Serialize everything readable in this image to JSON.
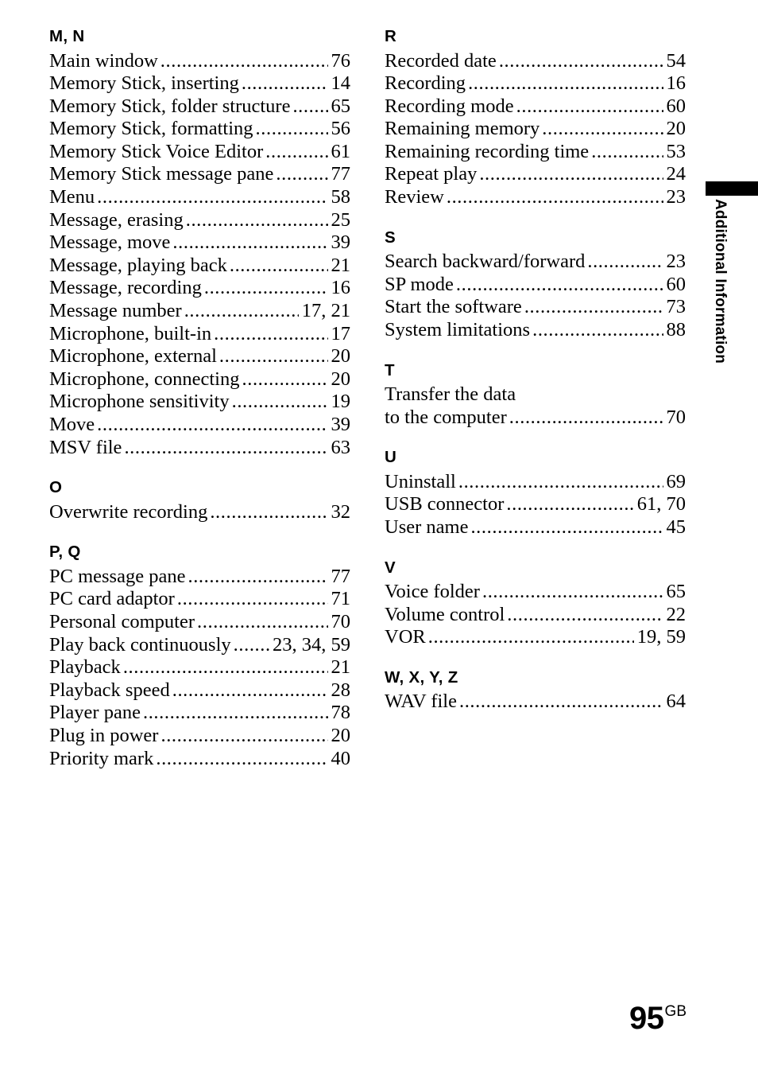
{
  "page": {
    "number": "95",
    "suffix": "GB"
  },
  "margin_tab": {
    "label": "Additional Information"
  },
  "columns": {
    "left": [
      {
        "heading": "M, N",
        "entries": [
          {
            "label": "Main window",
            "page": "76"
          },
          {
            "label": "Memory Stick, inserting",
            "page": "14"
          },
          {
            "label": "Memory Stick, folder structure",
            "page": "65"
          },
          {
            "label": "Memory Stick, formatting",
            "page": "56"
          },
          {
            "label": "Memory Stick Voice Editor",
            "page": "61"
          },
          {
            "label": "Memory Stick message pane",
            "page": "77"
          },
          {
            "label": "Menu",
            "page": "58"
          },
          {
            "label": "Message, erasing",
            "page": "25"
          },
          {
            "label": "Message, move",
            "page": "39"
          },
          {
            "label": "Message, playing back",
            "page": "21"
          },
          {
            "label": "Message, recording",
            "page": "16"
          },
          {
            "label": "Message number",
            "page": "17, 21"
          },
          {
            "label": "Microphone, built-in",
            "page": "17"
          },
          {
            "label": "Microphone, external",
            "page": "20"
          },
          {
            "label": "Microphone, connecting",
            "page": "20"
          },
          {
            "label": "Microphone sensitivity",
            "page": "19"
          },
          {
            "label": "Move",
            "page": "39"
          },
          {
            "label": "MSV file",
            "page": "63"
          }
        ]
      },
      {
        "heading": "O",
        "entries": [
          {
            "label": "Overwrite recording",
            "page": "32"
          }
        ]
      },
      {
        "heading": "P, Q",
        "entries": [
          {
            "label": "PC message pane",
            "page": "77"
          },
          {
            "label": "PC card adaptor",
            "page": "71"
          },
          {
            "label": "Personal computer",
            "page": "70"
          },
          {
            "label": "Play back continuously",
            "page": "23, 34, 59"
          },
          {
            "label": "Playback",
            "page": "21"
          },
          {
            "label": "Playback speed",
            "page": "28"
          },
          {
            "label": "Player pane",
            "page": "78"
          },
          {
            "label": "Plug in power",
            "page": "20"
          },
          {
            "label": "Priority mark",
            "page": "40"
          }
        ]
      }
    ],
    "right": [
      {
        "heading": "R",
        "entries": [
          {
            "label": "Recorded date",
            "page": "54"
          },
          {
            "label": "Recording",
            "page": "16"
          },
          {
            "label": "Recording mode",
            "page": "60"
          },
          {
            "label": "Remaining memory",
            "page": "20"
          },
          {
            "label": "Remaining recording time",
            "page": "53"
          },
          {
            "label": "Repeat play",
            "page": "24"
          },
          {
            "label": "Review",
            "page": "23"
          }
        ]
      },
      {
        "heading": "S",
        "entries": [
          {
            "label": "Search backward/forward",
            "page": "23"
          },
          {
            "label": "SP mode",
            "page": "60"
          },
          {
            "label": "Start the software",
            "page": "73"
          },
          {
            "label": "System limitations",
            "page": "88"
          }
        ]
      },
      {
        "heading": "T",
        "entries": [
          {
            "first_line": "Transfer the data",
            "label": "to the computer",
            "page": "70"
          }
        ]
      },
      {
        "heading": "U",
        "entries": [
          {
            "label": "Uninstall",
            "page": "69"
          },
          {
            "label": "USB connector",
            "page": "61, 70"
          },
          {
            "label": "User name",
            "page": "45"
          }
        ]
      },
      {
        "heading": "V",
        "entries": [
          {
            "label": "Voice folder",
            "page": "65"
          },
          {
            "label": "Volume control",
            "page": "22"
          },
          {
            "label": "VOR",
            "page": "19, 59"
          }
        ]
      },
      {
        "heading": "W, X, Y, Z",
        "entries": [
          {
            "label": "WAV file",
            "page": "64"
          }
        ]
      }
    ]
  }
}
